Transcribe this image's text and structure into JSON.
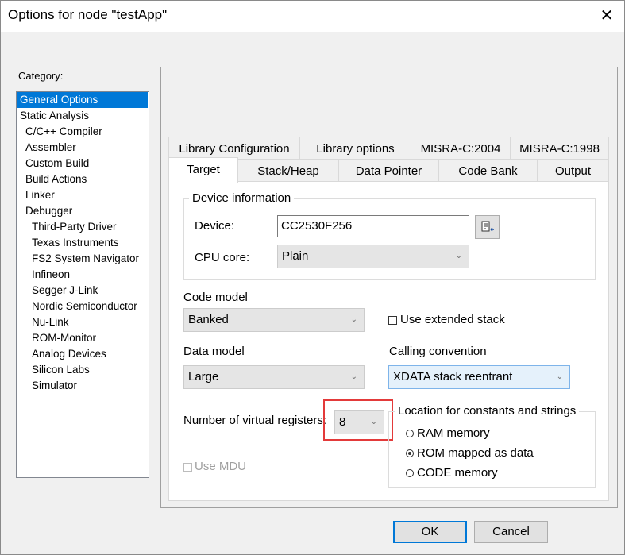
{
  "window": {
    "title": "Options for node \"testApp\"",
    "close_glyph": "✕"
  },
  "category": {
    "label": "Category:",
    "selected_index": 0,
    "items": [
      {
        "label": "General Options",
        "indent": 0
      },
      {
        "label": "Static Analysis",
        "indent": 0
      },
      {
        "label": "C/C++ Compiler",
        "indent": 1
      },
      {
        "label": "Assembler",
        "indent": 1
      },
      {
        "label": "Custom Build",
        "indent": 1
      },
      {
        "label": "Build Actions",
        "indent": 1
      },
      {
        "label": "Linker",
        "indent": 1
      },
      {
        "label": "Debugger",
        "indent": 1
      },
      {
        "label": "Third-Party Driver",
        "indent": 2
      },
      {
        "label": "Texas Instruments",
        "indent": 2
      },
      {
        "label": "FS2 System Navigator",
        "indent": 2
      },
      {
        "label": "Infineon",
        "indent": 2
      },
      {
        "label": "Segger J-Link",
        "indent": 2
      },
      {
        "label": "Nordic Semiconductor",
        "indent": 2
      },
      {
        "label": "Nu-Link",
        "indent": 2
      },
      {
        "label": "ROM-Monitor",
        "indent": 2
      },
      {
        "label": "Analog Devices",
        "indent": 2
      },
      {
        "label": "Silicon Labs",
        "indent": 2
      },
      {
        "label": "Simulator",
        "indent": 2
      }
    ]
  },
  "tabs": {
    "row1": [
      "Library Configuration",
      "Library options",
      "MISRA-C:2004",
      "MISRA-C:1998"
    ],
    "row2": [
      "Target",
      "Stack/Heap",
      "Data Pointer",
      "Code Bank",
      "Output"
    ],
    "active": "Target"
  },
  "device_info": {
    "group_label": "Device information",
    "device_label": "Device:",
    "device_value": "CC2530F256",
    "cpu_core_label": "CPU core:",
    "cpu_core_value": "Plain"
  },
  "code_model": {
    "label": "Code model",
    "value": "Banked"
  },
  "use_extended_stack": {
    "label": "Use extended stack",
    "checked": false
  },
  "data_model": {
    "label": "Data model",
    "value": "Large"
  },
  "calling_convention": {
    "label": "Calling convention",
    "value": "XDATA stack reentrant"
  },
  "virtual_registers": {
    "label": "Number of virtual registers:",
    "value": "8"
  },
  "use_mdu": {
    "label": "Use MDU",
    "checked": false,
    "enabled": false
  },
  "location": {
    "group_label": "Location for constants and strings",
    "options": [
      "RAM memory",
      "ROM mapped as data",
      "CODE memory"
    ],
    "selected": "ROM mapped as data"
  },
  "buttons": {
    "ok": "OK",
    "cancel": "Cancel"
  },
  "chevron_glyph": "⌄",
  "icons": {
    "browse": "device-select-icon",
    "highlight_color": "#e33a3a",
    "selection_color": "#0078d7"
  }
}
